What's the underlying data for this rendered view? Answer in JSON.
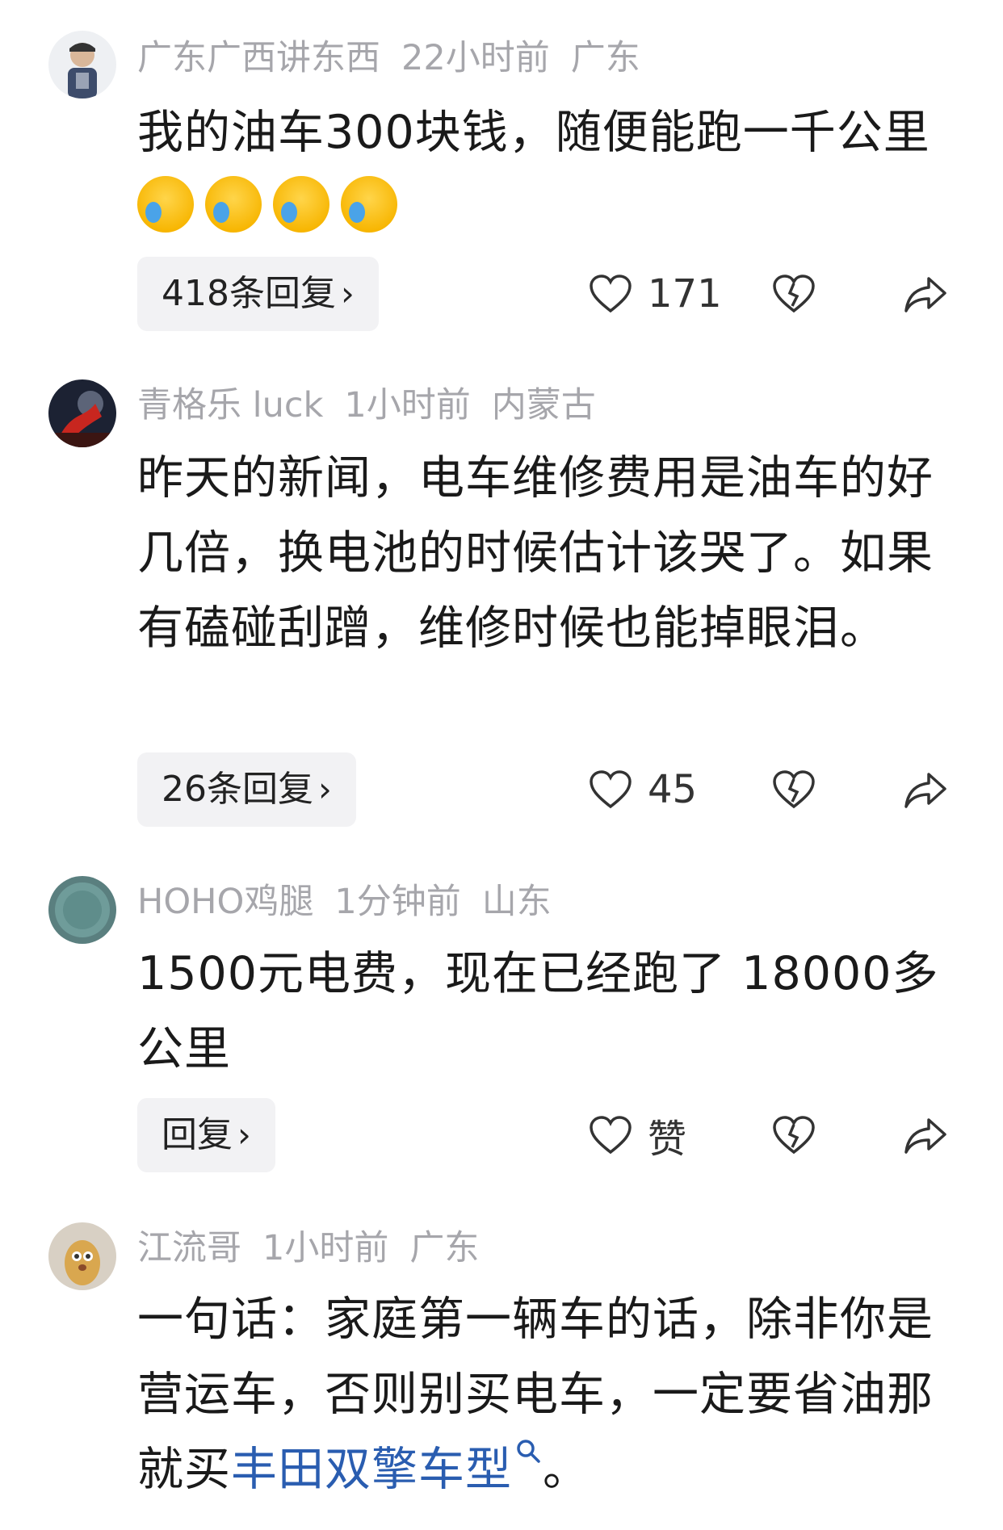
{
  "comments": [
    {
      "user": "广东广西讲东西",
      "time": "22小时前",
      "location": "广东",
      "text": "我的油车300块钱，随便能跑一千公里",
      "emoji": "laugh-cry-emoji",
      "reply_label": "418条回复",
      "likes": "171"
    },
    {
      "user": "青格乐 luck",
      "time": "1小时前",
      "location": "内蒙古",
      "text": "昨天的新闻，电车维修费用是油车的好几倍，换电池的时候估计该哭了。如果有磕碰刮蹭，维修时候也能掉眼泪。",
      "reply_label": "26条回复",
      "likes": "45"
    },
    {
      "user": "HOHO鸡腿",
      "time": "1分钟前",
      "location": "山东",
      "text": "1500元电费，现在已经跑了 18000多公里",
      "reply_label": "回复",
      "likes": "赞"
    },
    {
      "user": "江流哥",
      "time": "1小时前",
      "location": "广东",
      "text_prefix": "一句话：家庭第一辆车的话，除非你是营运车，否则别买电车，一定要省油那就买",
      "text_link": "丰田双擎车型",
      "text_suffix": "。"
    }
  ],
  "icons": {
    "like": "heart-outline-icon",
    "dislike": "broken-heart-icon",
    "share": "share-arrow-icon",
    "search": "search-icon",
    "chevron": "chevron-right-icon"
  },
  "colors": {
    "meta": "#a6a6ab",
    "text": "#1a1a1a",
    "link": "#2a5db0",
    "pill_bg": "#f2f2f4"
  }
}
